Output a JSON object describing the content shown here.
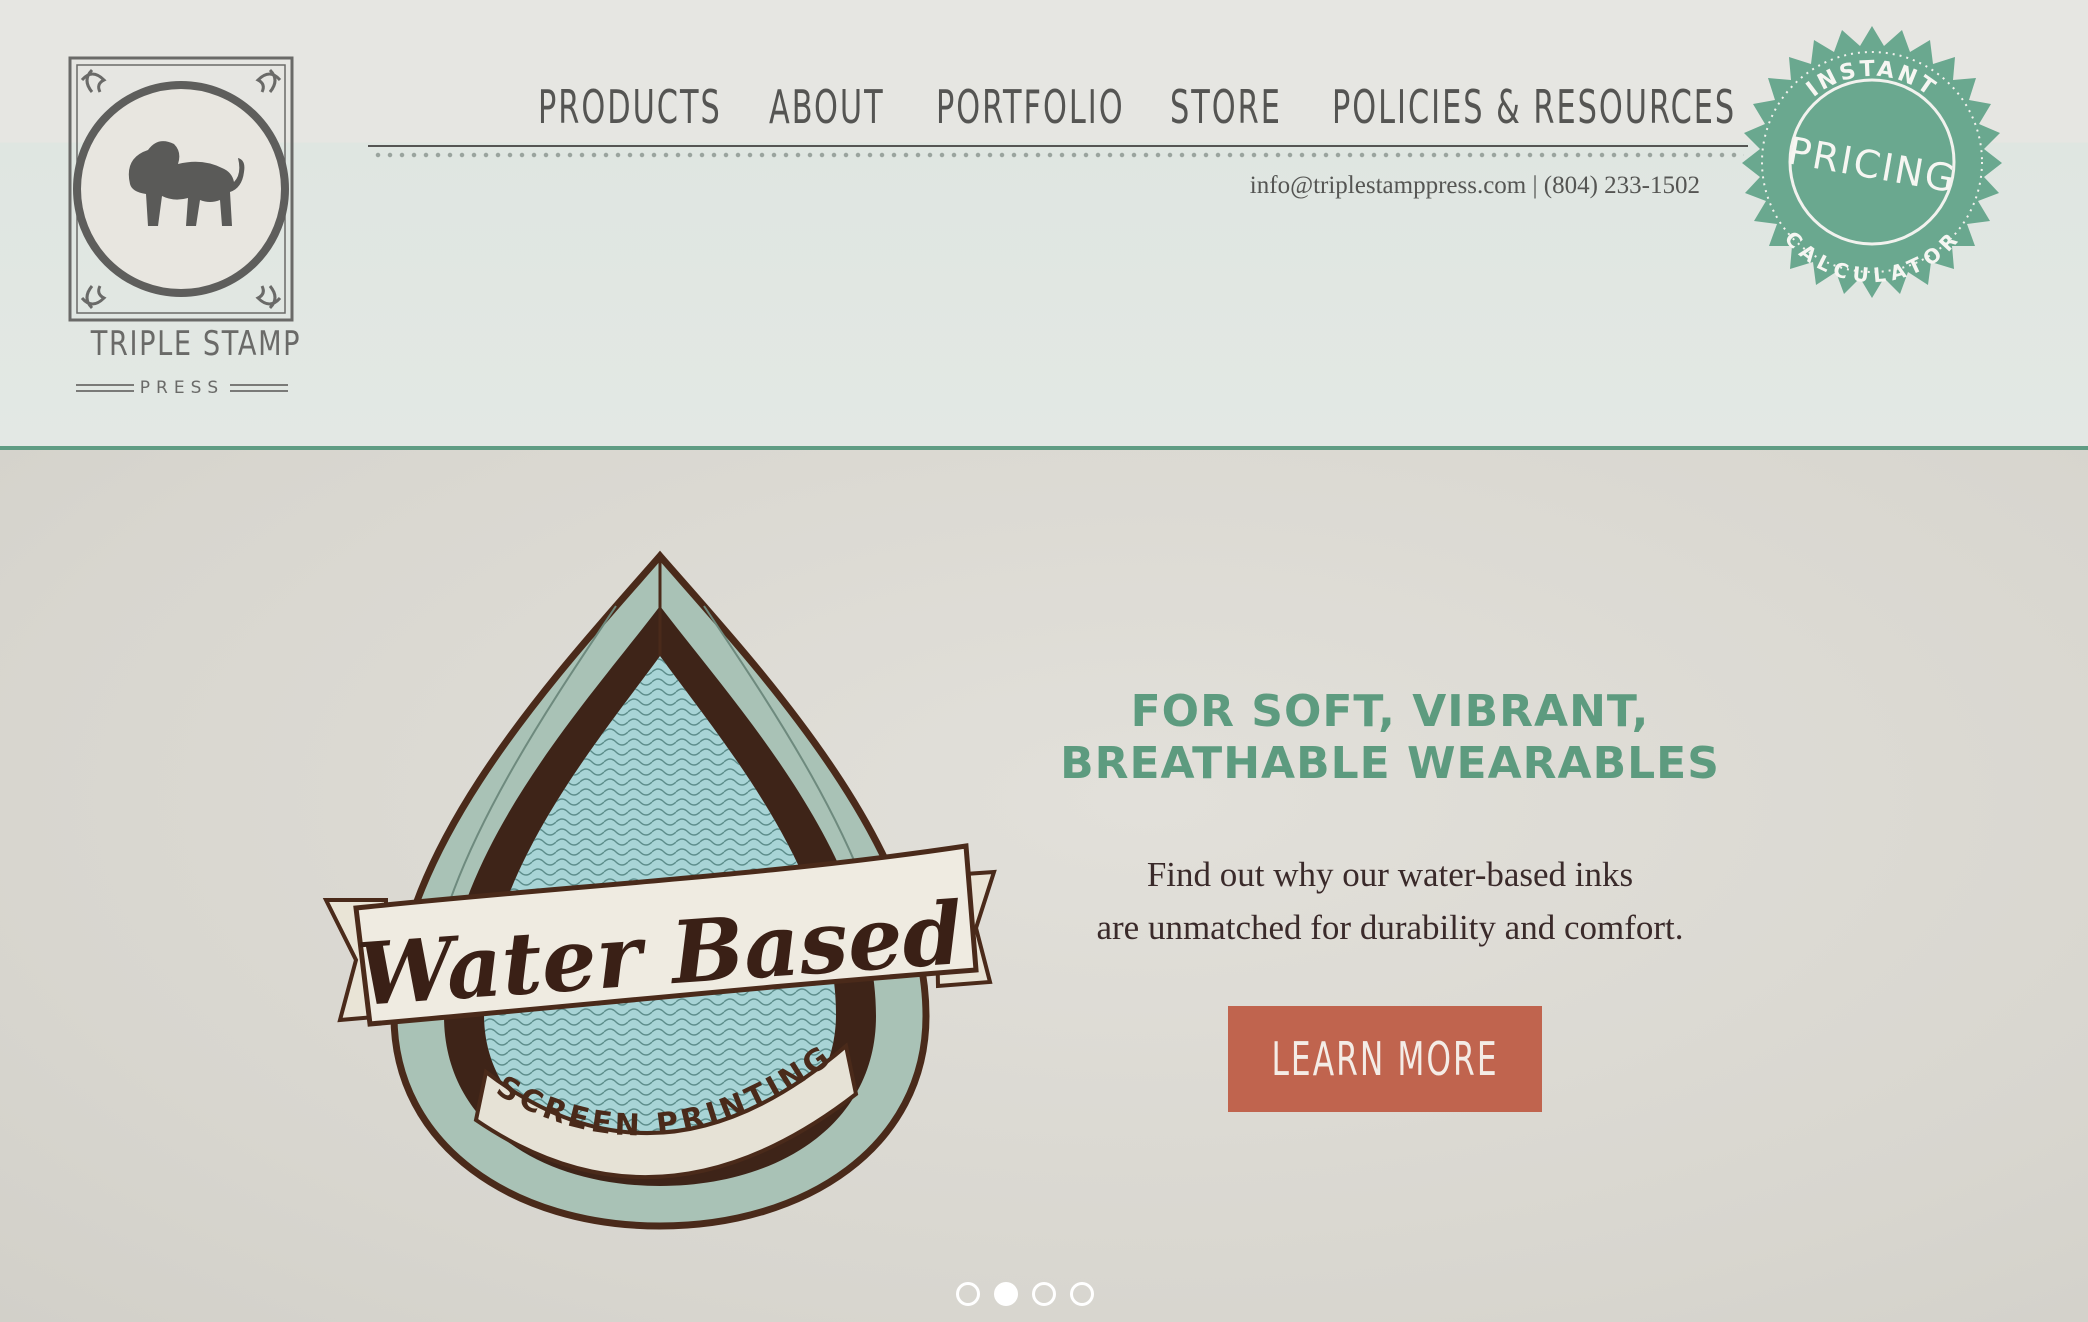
{
  "brand": {
    "name": "TRIPLE STAMP",
    "sub": "PRESS"
  },
  "nav": {
    "items": [
      {
        "label": "PRODUCTS"
      },
      {
        "label": "ABOUT"
      },
      {
        "label": "PORTFOLIO"
      },
      {
        "label": "STORE"
      },
      {
        "label": "POLICIES & RESOURCES"
      }
    ]
  },
  "contact": {
    "email": "info@triplestamppress.com",
    "separator": "|",
    "phone": "(804) 233-1502"
  },
  "badge": {
    "top": "INSTANT",
    "middle": "PRICING",
    "bottom": "CALCULATOR",
    "color": "#6aa88f"
  },
  "hero": {
    "emblem": {
      "banner": "Water Based",
      "ribbon": "SCREEN PRINTING"
    },
    "heading_line1": "FOR SOFT, VIBRANT,",
    "heading_line2": "BREATHABLE WEARABLES",
    "body_line1": "Find out why our water-based inks",
    "body_line2": "are unmatched for durability and comfort.",
    "cta_label": "LEARN MORE",
    "cta_color": "#c0644e",
    "heading_color": "#5d9b7f"
  },
  "slider": {
    "total": 4,
    "active_index": 1
  }
}
